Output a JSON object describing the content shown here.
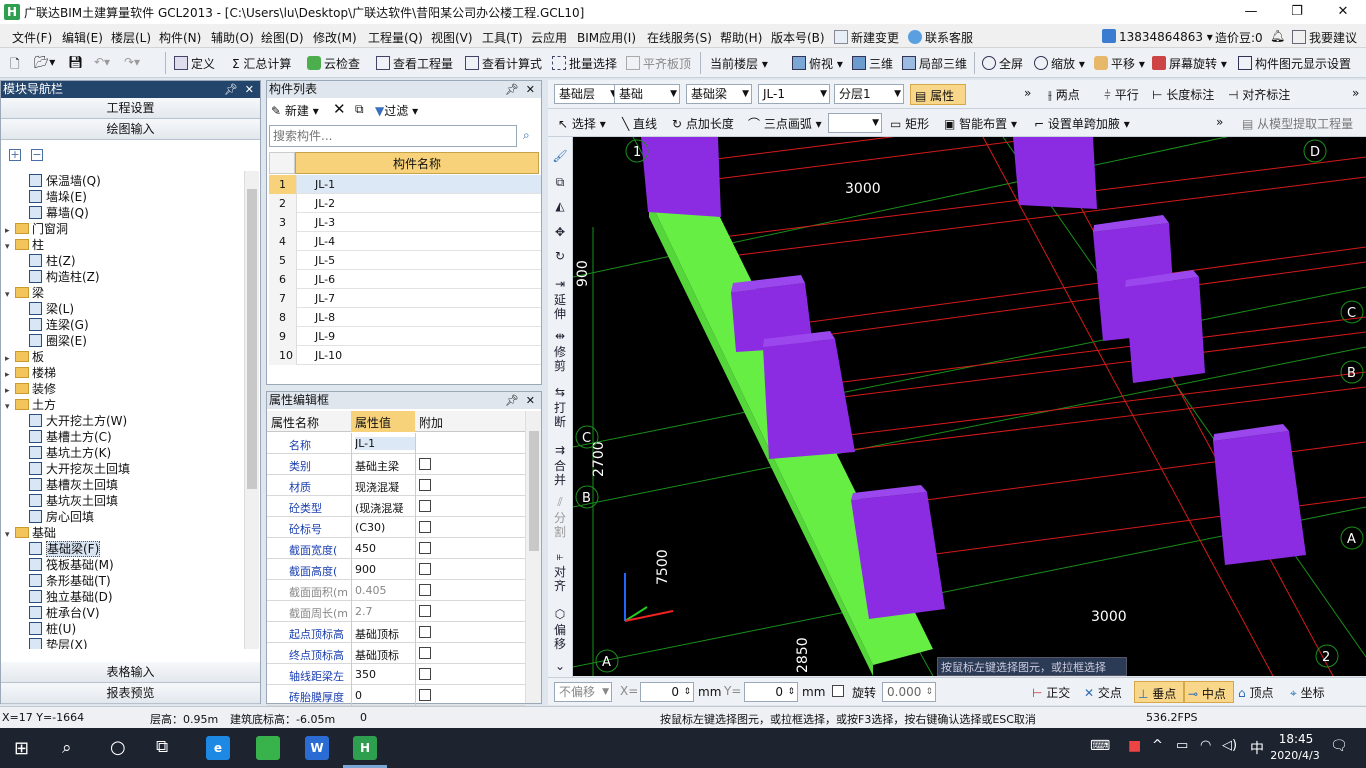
{
  "window": {
    "title": "广联达BIM土建算量软件 GCL2013 - [C:\\Users\\lu\\Desktop\\广联达软件\\昔阳某公司办公楼工程.GCL10]",
    "min": "—",
    "max": "❐",
    "close": "✕"
  },
  "menu": [
    "文件(F)",
    "编辑(E)",
    "楼层(L)",
    "构件(N)",
    "辅助(O)",
    "绘图(D)",
    "修改(M)",
    "工程量(Q)",
    "视图(V)",
    "工具(T)",
    "云应用",
    "BIM应用(I)",
    "在线服务(S)",
    "帮助(H)",
    "版本号(B)",
    "新建变更",
    "联系客服"
  ],
  "account": {
    "phone": "13834864863",
    "coins": "造价豆:0",
    "suggest": "我要建议"
  },
  "toolbar": {
    "define": "定义",
    "sum": "汇总计算",
    "cloudcheck": "云检查",
    "viewqty": "查看工程量",
    "viewformula": "查看计算式",
    "batchsel": "批量选择",
    "flatboard": "平齐板顶",
    "curfloor": "当前楼层",
    "topview": "俯视",
    "threed": "三维",
    "local3d": "局部三维",
    "fullscreen": "全屏",
    "zoom": "缩放",
    "pan": "平移",
    "rotate": "屏幕旋转",
    "displaysetting": "构件图元显示设置"
  },
  "nav": {
    "title": "模块导航栏",
    "project_settings": "工程设置",
    "draw_input": "绘图输入",
    "table_input": "表格输入",
    "report_preview": "报表预览",
    "tree": [
      {
        "label": "保温墙(Q)",
        "lvl": 2,
        "type": "leaf"
      },
      {
        "label": "墙垛(E)",
        "lvl": 2,
        "type": "leaf"
      },
      {
        "label": "幕墙(Q)",
        "lvl": 2,
        "type": "leaf"
      },
      {
        "label": "门窗洞",
        "lvl": 1,
        "type": "folder",
        "tog": "+"
      },
      {
        "label": "柱",
        "lvl": 1,
        "type": "folder",
        "tog": "-"
      },
      {
        "label": "柱(Z)",
        "lvl": 2,
        "type": "leaf"
      },
      {
        "label": "构造柱(Z)",
        "lvl": 2,
        "type": "leaf"
      },
      {
        "label": "梁",
        "lvl": 1,
        "type": "folder",
        "tog": "-"
      },
      {
        "label": "梁(L)",
        "lvl": 2,
        "type": "leaf"
      },
      {
        "label": "连梁(G)",
        "lvl": 2,
        "type": "leaf"
      },
      {
        "label": "圈梁(E)",
        "lvl": 2,
        "type": "leaf"
      },
      {
        "label": "板",
        "lvl": 1,
        "type": "folder",
        "tog": "+"
      },
      {
        "label": "楼梯",
        "lvl": 1,
        "type": "folder",
        "tog": "+"
      },
      {
        "label": "装修",
        "lvl": 1,
        "type": "folder",
        "tog": "+"
      },
      {
        "label": "土方",
        "lvl": 1,
        "type": "folder",
        "tog": "-"
      },
      {
        "label": "大开挖土方(W)",
        "lvl": 2,
        "type": "leaf"
      },
      {
        "label": "基槽土方(C)",
        "lvl": 2,
        "type": "leaf"
      },
      {
        "label": "基坑土方(K)",
        "lvl": 2,
        "type": "leaf"
      },
      {
        "label": "大开挖灰土回填",
        "lvl": 2,
        "type": "leaf"
      },
      {
        "label": "基槽灰土回填",
        "lvl": 2,
        "type": "leaf"
      },
      {
        "label": "基坑灰土回填",
        "lvl": 2,
        "type": "leaf"
      },
      {
        "label": "房心回填",
        "lvl": 2,
        "type": "leaf"
      },
      {
        "label": "基础",
        "lvl": 1,
        "type": "folder",
        "tog": "-"
      },
      {
        "label": "基础梁(F)",
        "lvl": 2,
        "type": "leaf",
        "selected": true
      },
      {
        "label": "筏板基础(M)",
        "lvl": 2,
        "type": "leaf"
      },
      {
        "label": "条形基础(T)",
        "lvl": 2,
        "type": "leaf"
      },
      {
        "label": "独立基础(D)",
        "lvl": 2,
        "type": "leaf"
      },
      {
        "label": "桩承台(V)",
        "lvl": 2,
        "type": "leaf"
      },
      {
        "label": "桩(U)",
        "lvl": 2,
        "type": "leaf"
      },
      {
        "label": "垫层(X)",
        "lvl": 2,
        "type": "leaf"
      }
    ]
  },
  "comp": {
    "title": "构件列表",
    "new": "新建",
    "filter": "过滤",
    "search_placeholder": "搜索构件...",
    "col_name": "构件名称",
    "rows": [
      "JL-1",
      "JL-2",
      "JL-3",
      "JL-4",
      "JL-5",
      "JL-6",
      "JL-7",
      "JL-8",
      "JL-9",
      "JL-10"
    ]
  },
  "props": {
    "title": "属性编辑框",
    "h_name": "属性名称",
    "h_value": "属性值",
    "h_extra": "附加",
    "rows": [
      {
        "k": "名称",
        "v": "JL-1",
        "gray": false
      },
      {
        "k": "类别",
        "v": "基础主梁",
        "gray": false
      },
      {
        "k": "材质",
        "v": "现浇混凝",
        "gray": false
      },
      {
        "k": "砼类型",
        "v": "(现浇混凝",
        "gray": false
      },
      {
        "k": "砼标号",
        "v": "(C30)",
        "gray": false
      },
      {
        "k": "截面宽度(",
        "v": "450",
        "gray": false
      },
      {
        "k": "截面高度(",
        "v": "900",
        "gray": false
      },
      {
        "k": "截面面积(m",
        "v": "0.405",
        "gray": true
      },
      {
        "k": "截面周长(m",
        "v": "2.7",
        "gray": true
      },
      {
        "k": "起点顶标高",
        "v": "基础顶标",
        "gray": false
      },
      {
        "k": "终点顶标高",
        "v": "基础顶标",
        "gray": false
      },
      {
        "k": "轴线距梁左",
        "v": "350",
        "gray": false
      },
      {
        "k": "砖胎膜厚度",
        "v": "0",
        "gray": false
      }
    ]
  },
  "ctrl": {
    "floor": "基础层",
    "cat": "基础",
    "type": "基础梁",
    "item": "JL-1",
    "layer": "分层1",
    "attr": "属性",
    "twopt": "两点",
    "parallel": "平行",
    "lenmark": "长度标注",
    "alignmark": "对齐标注",
    "select": "选择",
    "line": "直线",
    "ptlen": "点加长度",
    "arc": "三点画弧",
    "rect": "矩形",
    "smart": "智能布置",
    "setspan": "设置单跨加腋",
    "extract": "从模型提取工程量"
  },
  "vtools": [
    "延伸",
    "修剪",
    "打断",
    "合并",
    "分割",
    "对齐",
    "偏移"
  ],
  "view": {
    "dims": [
      "3000",
      "3000",
      "900",
      "2700",
      "7500",
      "2850"
    ],
    "axes": [
      "1",
      "D",
      "C",
      "B",
      "A",
      "2",
      "C",
      "B",
      "A"
    ],
    "hint": "按鼠标左键选择图元，或拉框选择"
  },
  "snap": {
    "nooffset": "不偏移",
    "x_label": "X=",
    "x_val": "0",
    "unit": "mm",
    "y_label": "Y=",
    "y_val": "0",
    "rotate": "旋转",
    "rot_val": "0.000",
    "ortho": "正交",
    "intersect": "交点",
    "perp": "垂点",
    "mid": "中点",
    "vertex": "顶点",
    "coord": "坐标"
  },
  "status": {
    "xy": "X=17 Y=-1664",
    "floorh": "层高：0.95m",
    "bottom": "建筑底标高：-6.05m",
    "zero": "0",
    "msg": "按鼠标左键选择图元，或拉框选择，或按F3选择，按右键确认选择或ESC取消",
    "fps": "536.2FPS"
  },
  "taskbar": {
    "time": "18:45",
    "date": "2020/4/3",
    "ime": "中"
  }
}
